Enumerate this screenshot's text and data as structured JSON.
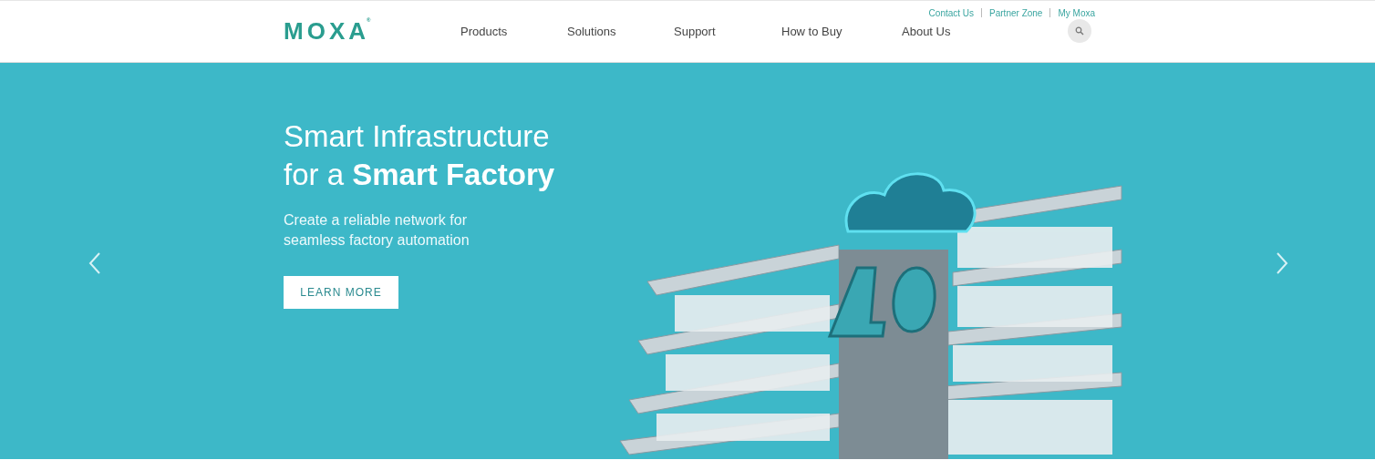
{
  "header": {
    "top_links": [
      "Contact Us",
      "Partner Zone",
      "My Moxa"
    ],
    "logo": {
      "text": "MOXA",
      "mark": "®"
    },
    "nav": [
      "Products",
      "Solutions",
      "Support",
      "How to Buy",
      "About Us"
    ]
  },
  "hero": {
    "title_line1": "Smart Infrastructure",
    "title_line2": "for a **Smart Factory**",
    "subtitle": "Create a reliable network for seamless factory automation",
    "button": "LEARN MORE"
  }
}
